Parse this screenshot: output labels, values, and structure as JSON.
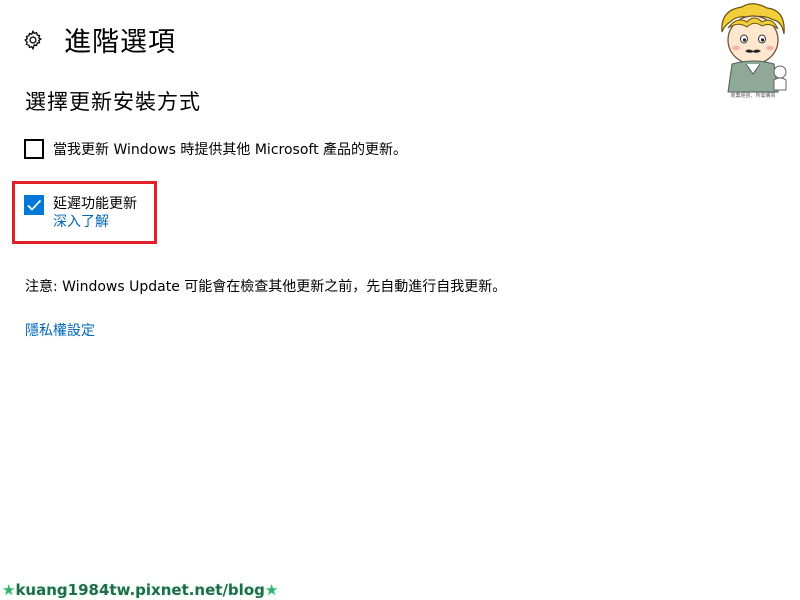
{
  "header": {
    "icon": "gear-icon",
    "title": "進階選項"
  },
  "section": {
    "heading": "選擇更新安裝方式"
  },
  "options": {
    "microsoft_products_label": "當我更新 Windows 時提供其他 Microsoft 產品的更新。",
    "microsoft_products_checked": false,
    "defer_label": "延遲功能更新",
    "defer_checked": true,
    "learn_more": "深入了解"
  },
  "note": "注意: Windows Update 可能會在檢查其他更新之前，先自動進行自我更新。",
  "privacy_link": "隱私權設定",
  "colors": {
    "accent": "#0078d7",
    "link": "#0067b8",
    "highlight": "#e0202a"
  },
  "watermark": {
    "text": "kuang1984tw.pixnet.net/blog",
    "star": "★"
  },
  "avatar": {
    "caption": "商業經營、所需購買"
  }
}
